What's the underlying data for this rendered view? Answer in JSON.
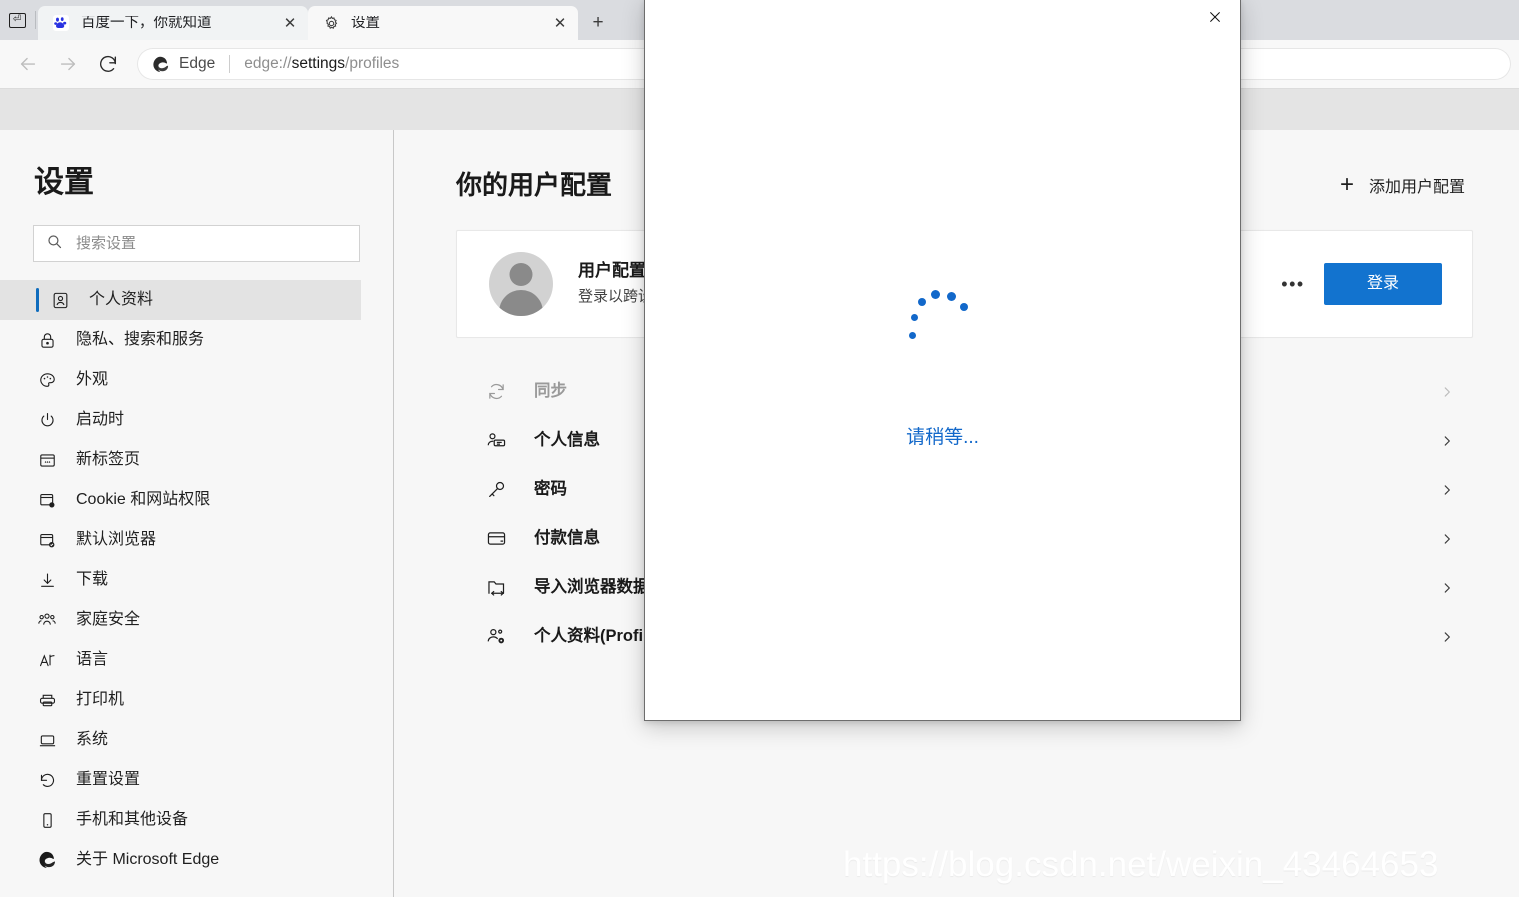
{
  "browser": {
    "tablist_icon": "tab-list-icon",
    "newtab_label": "+",
    "tabs": [
      {
        "title": "百度一下，你就知道",
        "favicon": "baidu-icon",
        "close_label": "✕",
        "active": false
      },
      {
        "title": "设置",
        "favicon": "gear-icon",
        "close_label": "✕",
        "active": true
      }
    ],
    "toolbar": {
      "back_icon": "back-arrow-icon",
      "forward_icon": "forward-arrow-icon",
      "reload_icon": "reload-icon",
      "edge_label": "Edge",
      "url_scheme": "edge://",
      "url_host": "settings",
      "url_path": "/profiles"
    }
  },
  "sidebar": {
    "title": "设置",
    "search": {
      "placeholder": "搜索设置",
      "value": "",
      "icon": "search-icon"
    },
    "items": [
      {
        "label": "个人资料",
        "icon": "profile-icon",
        "selected": true
      },
      {
        "label": "隐私、搜索和服务",
        "icon": "lock-icon",
        "selected": false
      },
      {
        "label": "外观",
        "icon": "palette-icon",
        "selected": false
      },
      {
        "label": "启动时",
        "icon": "power-icon",
        "selected": false
      },
      {
        "label": "新标签页",
        "icon": "new-tab-icon",
        "selected": false
      },
      {
        "label": "Cookie 和网站权限",
        "icon": "cookie-icon",
        "selected": false
      },
      {
        "label": "默认浏览器",
        "icon": "default-browser-icon",
        "selected": false
      },
      {
        "label": "下载",
        "icon": "download-icon",
        "selected": false
      },
      {
        "label": "家庭安全",
        "icon": "family-icon",
        "selected": false
      },
      {
        "label": "语言",
        "icon": "language-icon",
        "selected": false
      },
      {
        "label": "打印机",
        "icon": "printer-icon",
        "selected": false
      },
      {
        "label": "系统",
        "icon": "system-icon",
        "selected": false
      },
      {
        "label": "重置设置",
        "icon": "reset-icon",
        "selected": false
      },
      {
        "label": "手机和其他设备",
        "icon": "phone-icon",
        "selected": false
      },
      {
        "label": "关于 Microsoft Edge",
        "icon": "edge-logo-icon",
        "selected": false
      }
    ]
  },
  "main": {
    "title": "你的用户配置",
    "add_profile": {
      "label": "添加用户配置",
      "icon": "plus-icon"
    },
    "profile_card": {
      "avatar_icon": "default-avatar-icon",
      "name": "用户配置",
      "subtitle": "登录以跨设",
      "more_label": "•••",
      "signin_label": "登录"
    },
    "rows": [
      {
        "label": "同步",
        "icon": "sync-icon",
        "disabled": true,
        "chevron": "chevron-right-icon"
      },
      {
        "label": "个人信息",
        "icon": "personal-info-icon",
        "disabled": false,
        "chevron": "chevron-right-icon"
      },
      {
        "label": "密码",
        "icon": "key-icon",
        "disabled": false,
        "chevron": "chevron-right-icon"
      },
      {
        "label": "付款信息",
        "icon": "credit-card-icon",
        "disabled": false,
        "chevron": "chevron-right-icon"
      },
      {
        "label": "导入浏览器数据",
        "icon": "import-icon",
        "disabled": false,
        "chevron": "chevron-right-icon"
      },
      {
        "label": "个人资料(Profil",
        "icon": "profile-settings-icon",
        "disabled": false,
        "chevron": "chevron-right-icon"
      }
    ]
  },
  "dialog": {
    "close_label": "✕",
    "spinner_icon": "loading-spinner-icon",
    "wait_text": "请稍等...",
    "accent_color": "#1268ca"
  },
  "watermark": {
    "text": "https://blog.csdn.net/weixin_43464653"
  },
  "colors": {
    "accent_blue": "#0f6cbd",
    "button_blue": "#1273cf",
    "spinner_blue": "#1268ca",
    "page_bg": "#f7f7f7",
    "tabstrip_bg": "#dadce0"
  }
}
